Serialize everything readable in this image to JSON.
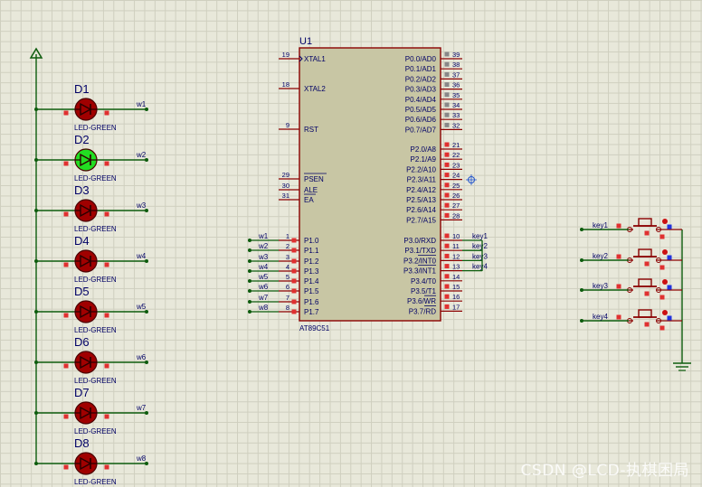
{
  "chip": {
    "ref": "U1",
    "part": "AT89C51",
    "left_pins": [
      {
        "num": "19",
        "name": "XTAL1"
      },
      {
        "num": "18",
        "name": "XTAL2"
      },
      {
        "num": "9",
        "name": "RST"
      },
      {
        "num": "29",
        "name": "PSEN"
      },
      {
        "num": "30",
        "name": "ALE"
      },
      {
        "num": "31",
        "name": "EA"
      },
      {
        "num": "1",
        "name": "P1.0"
      },
      {
        "num": "2",
        "name": "P1.1"
      },
      {
        "num": "3",
        "name": "P1.2"
      },
      {
        "num": "4",
        "name": "P1.3"
      },
      {
        "num": "5",
        "name": "P1.4"
      },
      {
        "num": "6",
        "name": "P1.5"
      },
      {
        "num": "7",
        "name": "P1.6"
      },
      {
        "num": "8",
        "name": "P1.7"
      }
    ],
    "right_pins": [
      {
        "num": "39",
        "name": "P0.0/AD0"
      },
      {
        "num": "38",
        "name": "P0.1/AD1"
      },
      {
        "num": "37",
        "name": "P0.2/AD2"
      },
      {
        "num": "36",
        "name": "P0.3/AD3"
      },
      {
        "num": "35",
        "name": "P0.4/AD4"
      },
      {
        "num": "34",
        "name": "P0.5/AD5"
      },
      {
        "num": "33",
        "name": "P0.6/AD6"
      },
      {
        "num": "32",
        "name": "P0.7/AD7"
      },
      {
        "num": "21",
        "name": "P2.0/A8"
      },
      {
        "num": "22",
        "name": "P2.1/A9"
      },
      {
        "num": "23",
        "name": "P2.2/A10"
      },
      {
        "num": "24",
        "name": "P2.3/A11"
      },
      {
        "num": "25",
        "name": "P2.4/A12"
      },
      {
        "num": "26",
        "name": "P2.5/A13"
      },
      {
        "num": "27",
        "name": "P2.6/A14"
      },
      {
        "num": "28",
        "name": "P2.7/A15"
      },
      {
        "num": "10",
        "name": "P3.0/RXD"
      },
      {
        "num": "11",
        "name": "P3.1/TXD"
      },
      {
        "num": "12",
        "name": "P3.2/INT0"
      },
      {
        "num": "13",
        "name": "P3.3/INT1"
      },
      {
        "num": "14",
        "name": "P3.4/T0"
      },
      {
        "num": "15",
        "name": "P3.5/T1"
      },
      {
        "num": "16",
        "name": "P3.6/WR"
      },
      {
        "num": "17",
        "name": "P3.7/RD"
      }
    ],
    "p1_net_labels": [
      "w1",
      "w2",
      "w3",
      "w4",
      "w5",
      "w6",
      "w7",
      "w8"
    ],
    "p3_net_labels": [
      "key1",
      "key2",
      "key3",
      "key4"
    ]
  },
  "leds": [
    {
      "ref": "D1",
      "type": "LED-GREEN",
      "net": "w1",
      "lit": false
    },
    {
      "ref": "D2",
      "type": "LED-GREEN",
      "net": "w2",
      "lit": true
    },
    {
      "ref": "D3",
      "type": "LED-GREEN",
      "net": "w3",
      "lit": false
    },
    {
      "ref": "D4",
      "type": "LED-GREEN",
      "net": "w4",
      "lit": false
    },
    {
      "ref": "D5",
      "type": "LED-GREEN",
      "net": "w5",
      "lit": false
    },
    {
      "ref": "D6",
      "type": "LED-GREEN",
      "net": "w6",
      "lit": false
    },
    {
      "ref": "D7",
      "type": "LED-GREEN",
      "net": "w7",
      "lit": false
    },
    {
      "ref": "D8",
      "type": "LED-GREEN",
      "net": "w8",
      "lit": false
    }
  ],
  "buttons": [
    {
      "net": "key1"
    },
    {
      "net": "key2"
    },
    {
      "net": "key3"
    },
    {
      "net": "key4"
    }
  ],
  "colors": {
    "wire": "#0d5c0d",
    "component": "#8b0000",
    "led_off": "#a00000",
    "led_on": "#22dd22",
    "chip_fill": "#c8c6a4",
    "text": "#000066",
    "pin_red": "#e03030"
  },
  "watermark": "CSDN @LCD-执棋困局"
}
